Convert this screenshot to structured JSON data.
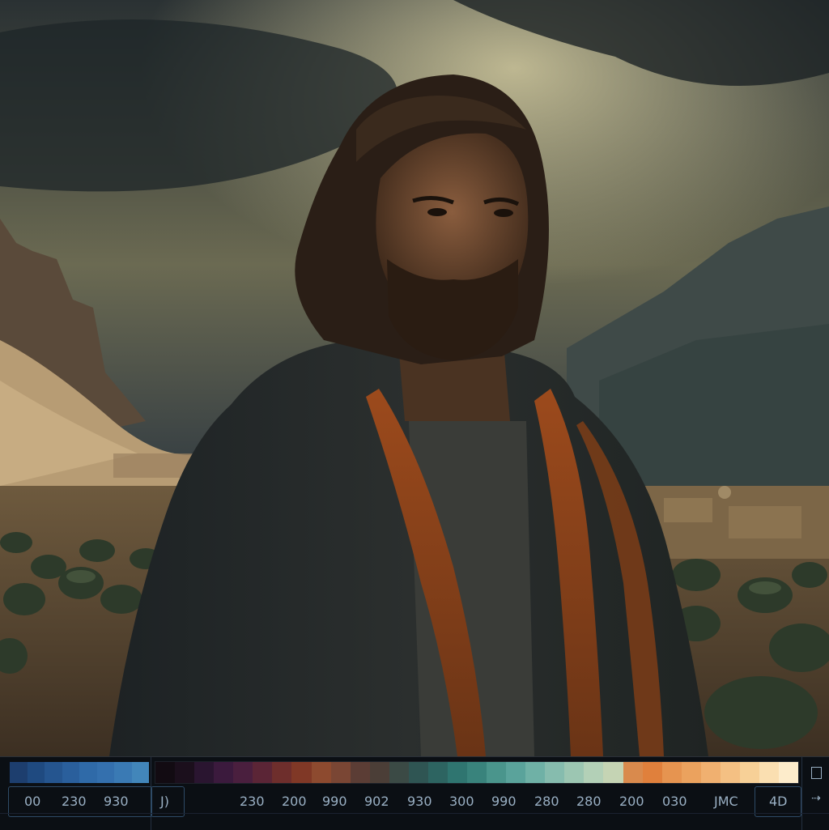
{
  "scene": {
    "description_icon": "image-canvas-icon"
  },
  "palette": {
    "left_swatches": [
      "#1d3e6e",
      "#1f4a80",
      "#25558f",
      "#2a5f9c",
      "#2f6aa8",
      "#3470ae",
      "#3a7ab4",
      "#4286ba"
    ],
    "main_swatches": [
      "#120b12",
      "#1b0f1c",
      "#2a1530",
      "#3b1a3d",
      "#4a1f3e",
      "#5b2536",
      "#6e2e2c",
      "#803826",
      "#8d4a2f",
      "#7a4634",
      "#5b3d35",
      "#4b3e37",
      "#3b4a45",
      "#2f5553",
      "#2d6461",
      "#2f7570",
      "#39837c",
      "#4a958c",
      "#5aa39b",
      "#6fb1a6",
      "#86bcae",
      "#9cc6b2",
      "#b3d0b7",
      "#c5d4b4",
      "#d98a4d",
      "#e0803c",
      "#e69450",
      "#eba25e",
      "#f0b070",
      "#f4c083",
      "#f7d097",
      "#fadfb1",
      "#fdeccb"
    ],
    "labels": [
      "00",
      "230",
      "930",
      "J)",
      "230",
      "200",
      "990",
      "902",
      "930",
      "300",
      "990",
      "280",
      "280",
      "200",
      "030",
      "JMC",
      "4D"
    ],
    "icons": {
      "square": "square-icon",
      "arrow": "arrow-right-icon"
    }
  }
}
